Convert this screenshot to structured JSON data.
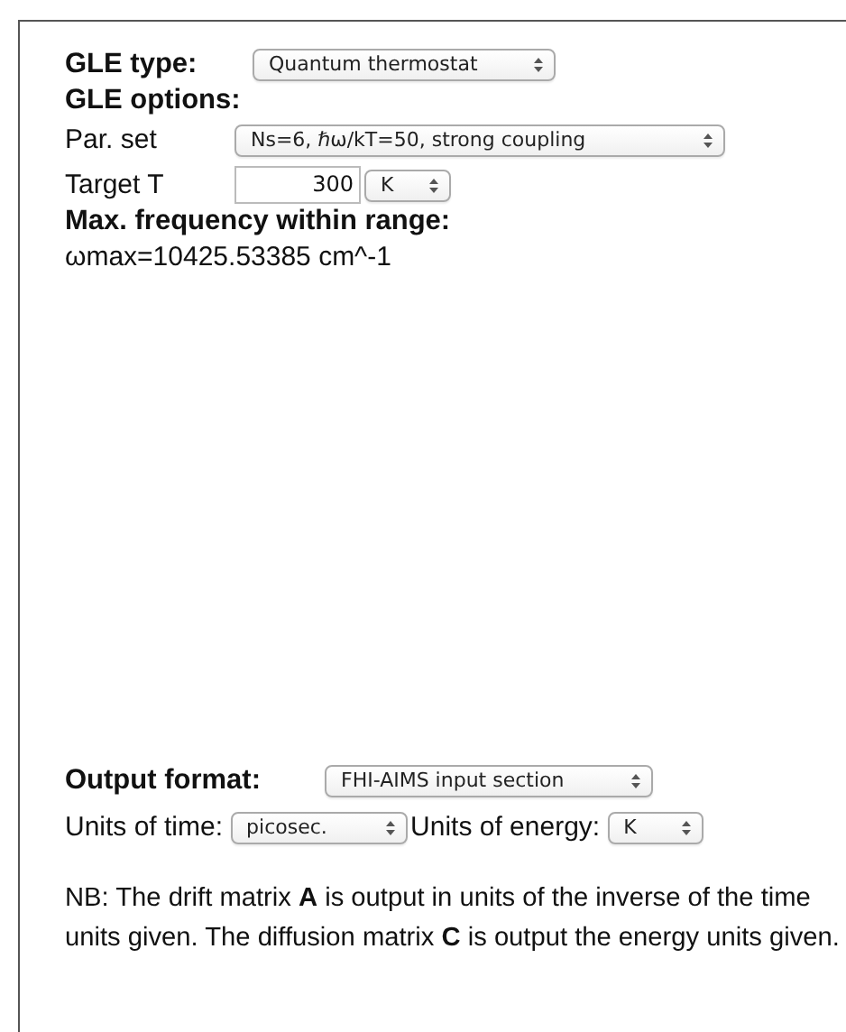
{
  "gle_type": {
    "label": "GLE type:",
    "value": "Quantum thermostat"
  },
  "gle_options": {
    "heading": "GLE options:",
    "par_set": {
      "label": "Par. set",
      "value": "Ns=6, ℏω/kT=50, strong coupling"
    },
    "target_t": {
      "label": "Target T",
      "value": "300",
      "unit": "K"
    }
  },
  "max_frequency": {
    "heading": "Max. frequency within range:",
    "value": "ωmax=10425.53385 cm^-1"
  },
  "output": {
    "label": "Output format:",
    "value": "FHI-AIMS input section",
    "time_label": "Units of time:",
    "time_value": "picosec.",
    "energy_label": "Units of energy:",
    "energy_value": "K"
  },
  "note": "NB: The drift matrix **A** is output in units of the inverse of the time units given. The diffusion matrix **C** is output the energy units given."
}
